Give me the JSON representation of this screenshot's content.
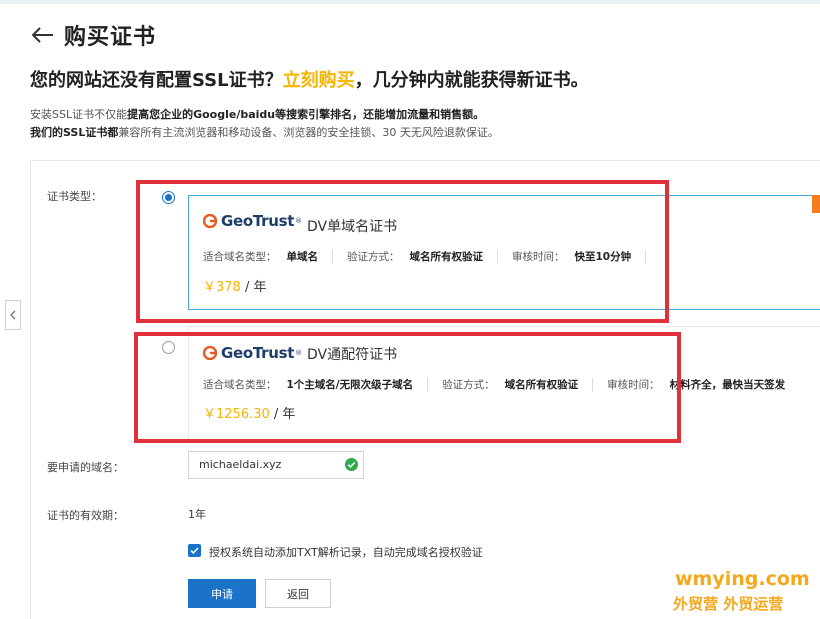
{
  "page": {
    "title": "购买证书"
  },
  "headline": {
    "part1": "您的网站还没有配置SSL证书？",
    "highlight": "立刻购买",
    "part2": "，几分钟内就能获得新证书。"
  },
  "description": {
    "line1_pre": "安装SSL证书不仅能",
    "line1_bold": "提高您企业的Google/baidu等搜索引擎排名，还能增加流量和销售额。",
    "line2_bold": "我们的SSL证书都",
    "line2_rest": "兼容所有主流浏览器和移动设备、浏览器的安全挂锁、30 天无风险退款保证。"
  },
  "form": {
    "cert_type_label": "证书类型：",
    "domain_label": "要申请的域名：",
    "validity_label": "证书的有效期："
  },
  "options": [
    {
      "brand": "GeoTrust",
      "brand_tm": "®",
      "product": "DV单域名证书",
      "domain_type_key": "适合域名类型：",
      "domain_type_val": "单域名",
      "verify_key": "验证方式：",
      "verify_val": "域名所有权验证",
      "review_key": "审核时间：",
      "review_val": "快至10分钟",
      "currency": "￥",
      "price": "378",
      "unit": " / 年",
      "selected": true
    },
    {
      "brand": "GeoTrust",
      "brand_tm": "®",
      "product": "DV通配符证书",
      "domain_type_key": "适合域名类型：",
      "domain_type_val": "1个主域名/无限次级子域名",
      "verify_key": "验证方式：",
      "verify_val": "域名所有权验证",
      "review_key": "审核时间：",
      "review_val": "材料齐全，最快当天签发",
      "currency": "￥",
      "price": "1256.30",
      "unit": " / 年",
      "selected": false
    }
  ],
  "domain_input": {
    "value": "michaeldai.xyz"
  },
  "validity": {
    "value": "1年"
  },
  "auth_checkbox": {
    "checked": true,
    "label": "授权系统自动添加TXT解析记录，自动完成域名授权验证"
  },
  "buttons": {
    "apply": "申请",
    "back": "返回"
  },
  "watermark": {
    "line1": "wmying.com",
    "line2": "外贸营 外贸运营"
  },
  "colors": {
    "accent": "#1a73c8",
    "price": "#f4b400",
    "highlight_border": "#e0303a",
    "watermark": "#f4a81d"
  }
}
